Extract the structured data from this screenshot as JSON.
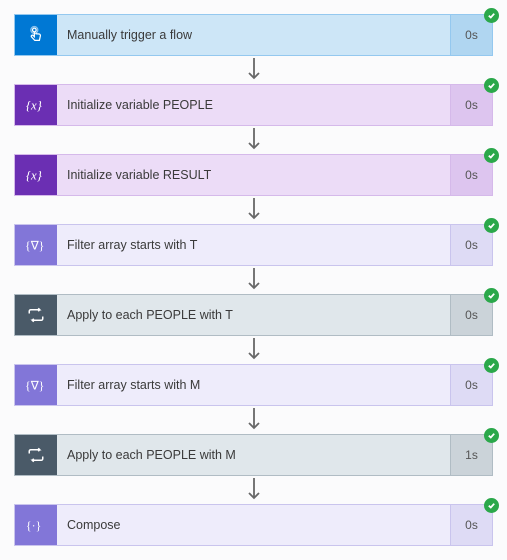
{
  "steps": [
    {
      "label": "Manually trigger a flow",
      "duration": "0s",
      "theme": "blue",
      "icon": "touch",
      "status": "success"
    },
    {
      "label": "Initialize variable PEOPLE",
      "duration": "0s",
      "theme": "dpurple",
      "icon": "var",
      "status": "success"
    },
    {
      "label": "Initialize variable RESULT",
      "duration": "0s",
      "theme": "dpurple",
      "icon": "var",
      "status": "success"
    },
    {
      "label": "Filter array starts with T",
      "duration": "0s",
      "theme": "lpurple",
      "icon": "filter",
      "status": "success"
    },
    {
      "label": "Apply to each PEOPLE with T",
      "duration": "0s",
      "theme": "gray",
      "icon": "loop",
      "status": "success"
    },
    {
      "label": "Filter array starts with M",
      "duration": "0s",
      "theme": "lpurple",
      "icon": "filter",
      "status": "success"
    },
    {
      "label": "Apply to each PEOPLE with M",
      "duration": "1s",
      "theme": "gray",
      "icon": "loop",
      "status": "success"
    },
    {
      "label": "Compose",
      "duration": "0s",
      "theme": "lpurple",
      "icon": "compose",
      "status": "success"
    }
  ]
}
